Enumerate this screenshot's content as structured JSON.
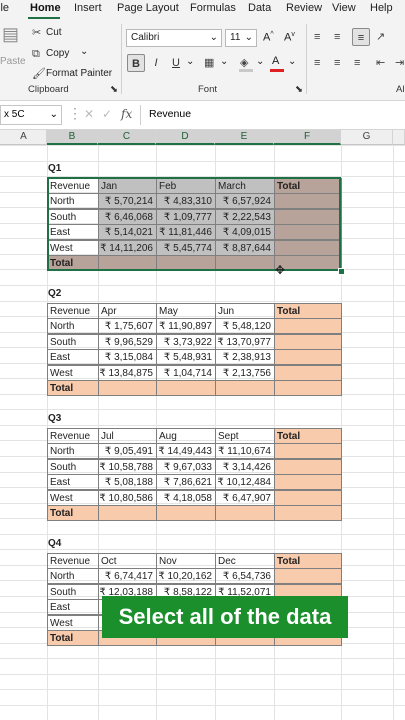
{
  "ribbon_tabs": [
    "ile",
    "Home",
    "Insert",
    "Page Layout",
    "Formulas",
    "Data",
    "Review",
    "View",
    "Help"
  ],
  "active_tab": "Home",
  "clipboard": {
    "paste": "Paste",
    "cut": "Cut",
    "copy": "Copy",
    "format_painter": "Format Painter",
    "group_label": "Clipboard"
  },
  "font": {
    "name": "Calibri",
    "size": "11",
    "grow": "A^",
    "shrink": "Av",
    "bold": "B",
    "italic": "I",
    "underline": "U",
    "group_label": "Font"
  },
  "alignment": {
    "partial_label": "Al"
  },
  "formula_bar": {
    "name_box": "x 5C",
    "fx": "fx",
    "content": "Revenue"
  },
  "columns": [
    "A",
    "B",
    "C",
    "D",
    "E",
    "F",
    "G"
  ],
  "accent_color": "#1e7145",
  "header_fill_color": "#f8cbad",
  "selected_fill_color": "#c0c0c0",
  "tables": [
    {
      "title": "Q1",
      "header": [
        "Revenue",
        "Jan",
        "Feb",
        "March",
        "Total"
      ],
      "rows": [
        [
          "North",
          "₹ 5,70,214",
          "₹ 4,83,310",
          "₹ 6,57,924",
          ""
        ],
        [
          "South",
          "₹ 6,46,068",
          "₹ 1,09,777",
          "₹ 2,22,543",
          ""
        ],
        [
          "East",
          "₹ 5,14,021",
          "₹ 11,81,446",
          "₹ 4,09,015",
          ""
        ],
        [
          "West",
          "₹ 14,11,206",
          "₹ 5,45,774",
          "₹ 8,87,644",
          ""
        ]
      ],
      "total_label": "Total"
    },
    {
      "title": "Q2",
      "header": [
        "Revenue",
        "Apr",
        "May",
        "Jun",
        "Total"
      ],
      "rows": [
        [
          "North",
          "₹ 1,75,607",
          "₹ 11,90,897",
          "₹ 5,48,120",
          ""
        ],
        [
          "South",
          "₹ 9,96,529",
          "₹ 3,73,922",
          "₹ 13,70,977",
          ""
        ],
        [
          "East",
          "₹ 3,15,084",
          "₹ 5,48,931",
          "₹ 2,38,913",
          ""
        ],
        [
          "West",
          "₹ 13,84,875",
          "₹ 1,04,714",
          "₹ 2,13,756",
          ""
        ]
      ],
      "total_label": "Total"
    },
    {
      "title": "Q3",
      "header": [
        "Revenue",
        "Jul",
        "Aug",
        "Sept",
        "Total"
      ],
      "rows": [
        [
          "North",
          "₹ 9,05,491",
          "₹ 14,49,443",
          "₹ 11,10,674",
          ""
        ],
        [
          "South",
          "₹ 10,58,788",
          "₹ 9,67,033",
          "₹ 3,14,426",
          ""
        ],
        [
          "East",
          "₹ 5,08,188",
          "₹ 7,86,621",
          "₹ 10,12,484",
          ""
        ],
        [
          "West",
          "₹ 10,80,586",
          "₹ 4,18,058",
          "₹ 6,47,907",
          ""
        ]
      ],
      "total_label": "Total"
    },
    {
      "title": "Q4",
      "header": [
        "Revenue",
        "Oct",
        "Nov",
        "Dec",
        "Total"
      ],
      "rows": [
        [
          "North",
          "₹ 6,74,417",
          "₹ 10,20,162",
          "₹ 6,54,736",
          ""
        ],
        [
          "South",
          "₹ 12,03,188",
          "₹ 8,58,122",
          "₹ 11,52,071",
          ""
        ],
        [
          "East",
          "",
          "",
          "",
          ""
        ],
        [
          "West",
          "",
          "",
          "",
          ""
        ]
      ],
      "total_label": "Total"
    }
  ],
  "caption": "Select all of the data"
}
